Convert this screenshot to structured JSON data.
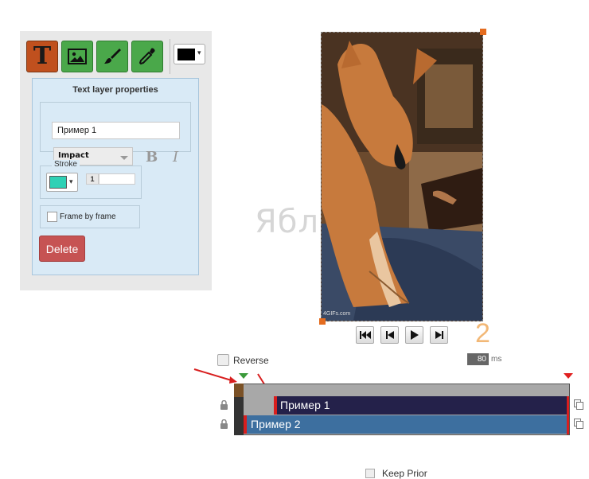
{
  "toolbar": {
    "tools": [
      {
        "name": "text-tool",
        "icon": "text-icon",
        "glyph": "T",
        "active": true
      },
      {
        "name": "image-tool",
        "icon": "image-icon",
        "active": false
      },
      {
        "name": "brush-tool",
        "icon": "brush-icon",
        "active": false
      },
      {
        "name": "eyedropper-tool",
        "icon": "eyedropper-icon",
        "active": false
      }
    ],
    "color_picker": {
      "color": "#000000",
      "caret": "▾"
    }
  },
  "text_props": {
    "title": "Text layer properties",
    "text_value": "Пример 1",
    "font": "Impact",
    "bold_glyph": "B",
    "italic_glyph": "I",
    "stroke": {
      "legend": "Stroke",
      "color": "#2ed1b5",
      "caret": "▾",
      "width": "1"
    },
    "frame_by_frame_label": "Frame by frame",
    "delete_label": "Delete"
  },
  "watermark": "ЯблЫ",
  "canvas": {
    "gif_credit": "4GIFs.com"
  },
  "playback": {
    "step_label": "2",
    "delay": "80",
    "delay_unit": "ms"
  },
  "reverse_label": "Reverse",
  "layers": [
    {
      "label": "Пример 1",
      "locked": true
    },
    {
      "label": "Пример 2",
      "locked": true
    }
  ],
  "bottom": {
    "keep_label": "Keep Prior"
  },
  "colors": {
    "accent_orange": "#e46c1f",
    "text_tool": "#c0501e",
    "tool_green": "#4aa84a",
    "delete_red": "#c65353",
    "layer1": "#24214a",
    "layer2": "#3d6f9f",
    "marker_red": "#d81e1e"
  }
}
